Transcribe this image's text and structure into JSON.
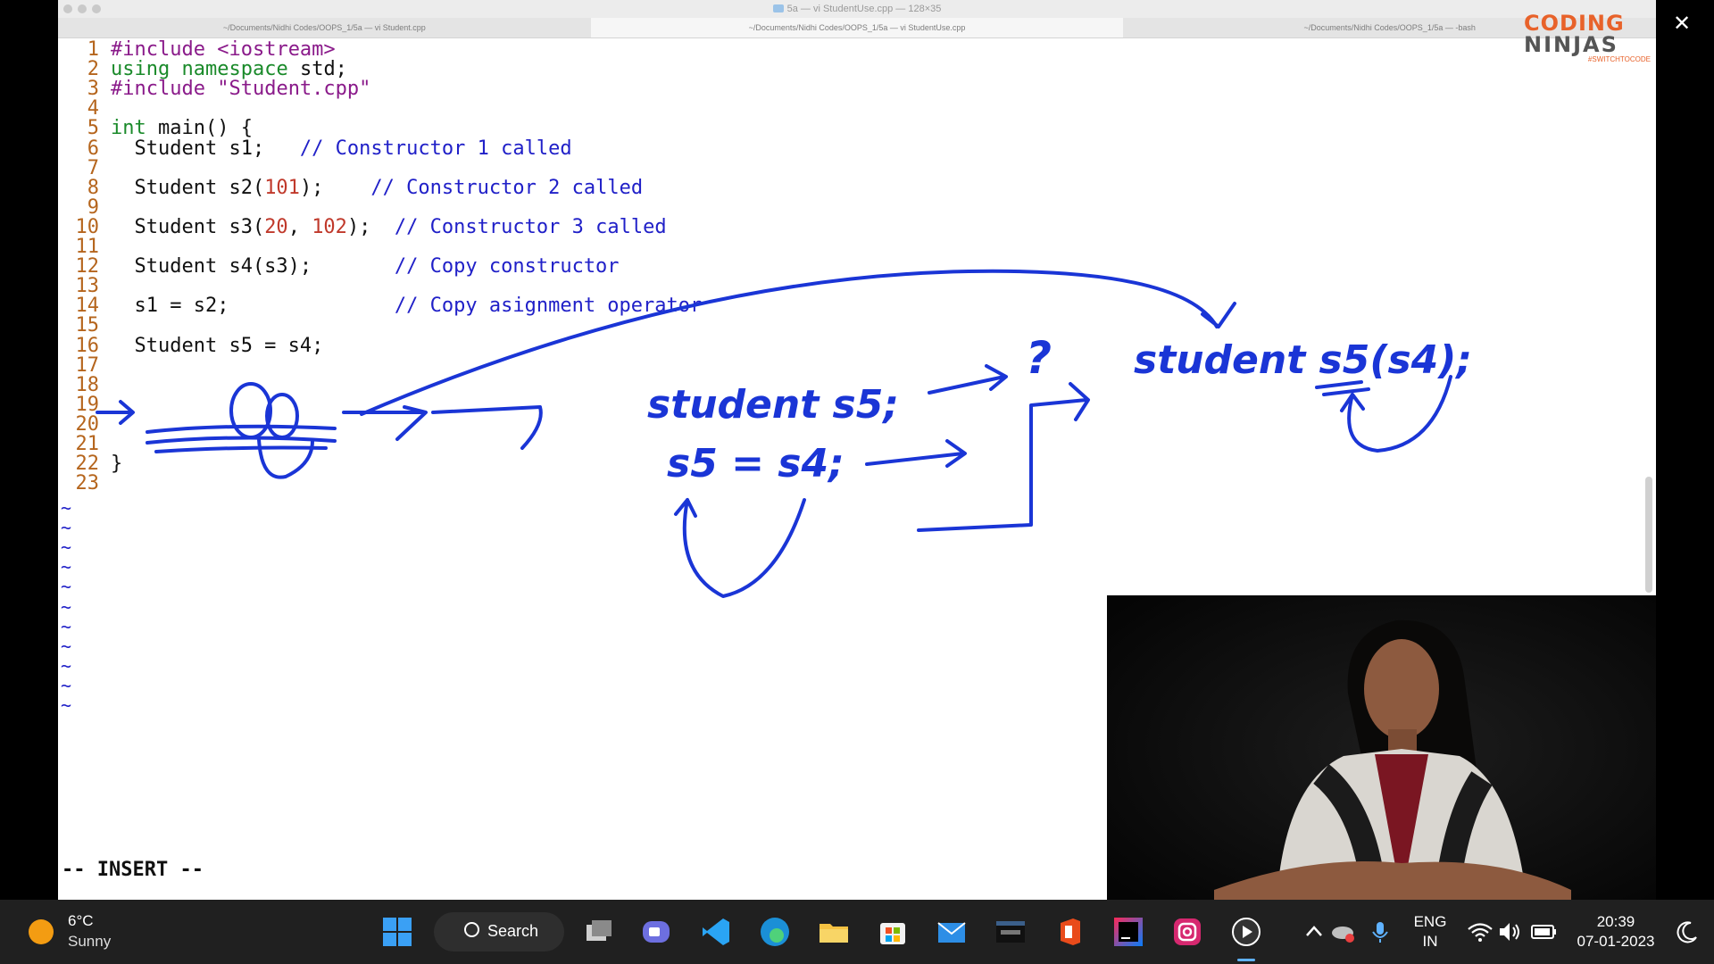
{
  "window": {
    "title": "5a — vi StudentUse.cpp — 128×35",
    "tabs": [
      "~/Documents/Nidhi Codes/OOPS_1/5a — vi Student.cpp",
      "~/Documents/Nidhi Codes/OOPS_1/5a — vi StudentUse.cpp",
      "~/Documents/Nidhi Codes/OOPS_1/5a — -bash"
    ]
  },
  "editor": {
    "lines": [
      {
        "n": "1",
        "t": "#include <iostream>"
      },
      {
        "n": "2",
        "t": "using namespace std;"
      },
      {
        "n": "3",
        "t": "#include \"Student.cpp\""
      },
      {
        "n": "4",
        "t": ""
      },
      {
        "n": "5",
        "t": "int main() {"
      },
      {
        "n": "6",
        "t": "  Student s1;   // Constructor 1 called"
      },
      {
        "n": "7",
        "t": ""
      },
      {
        "n": "8",
        "t": "  Student s2(101);    // Constructor 2 called"
      },
      {
        "n": "9",
        "t": ""
      },
      {
        "n": "10",
        "t": "  Student s3(20, 102);  // Constructor 3 called"
      },
      {
        "n": "11",
        "t": ""
      },
      {
        "n": "12",
        "t": "  Student s4(s3);       // Copy constructor"
      },
      {
        "n": "13",
        "t": ""
      },
      {
        "n": "14",
        "t": "  s1 = s2;              // Copy asignment operator"
      },
      {
        "n": "15",
        "t": ""
      },
      {
        "n": "16",
        "t": "  Student s5 = s4;"
      },
      {
        "n": "17",
        "t": ""
      },
      {
        "n": "18",
        "t": ""
      },
      {
        "n": "19",
        "t": ""
      },
      {
        "n": "20",
        "t": ""
      },
      {
        "n": "21",
        "t": ""
      },
      {
        "n": "22",
        "t": "}"
      },
      {
        "n": "23",
        "t": ""
      }
    ],
    "tilde": "~",
    "mode": "-- INSERT --"
  },
  "annotations": {
    "note1": "student s5;",
    "note2": "s5 = s4;",
    "note3": "?",
    "note4": "student s5(s4);"
  },
  "logo": {
    "top": "CODING",
    "bottom": "NINJAS",
    "tag": "#SWITCHTOCODE"
  },
  "taskbar": {
    "weather_temp": "6°C",
    "weather_desc": "Sunny",
    "search_label": "Search",
    "lang_top": "ENG",
    "lang_bottom": "IN",
    "time": "20:39",
    "date": "07-01-2023"
  },
  "colors": {
    "ink": "#1a35d6",
    "accent": "#e8622a",
    "line_numbers": "#b5651d"
  }
}
